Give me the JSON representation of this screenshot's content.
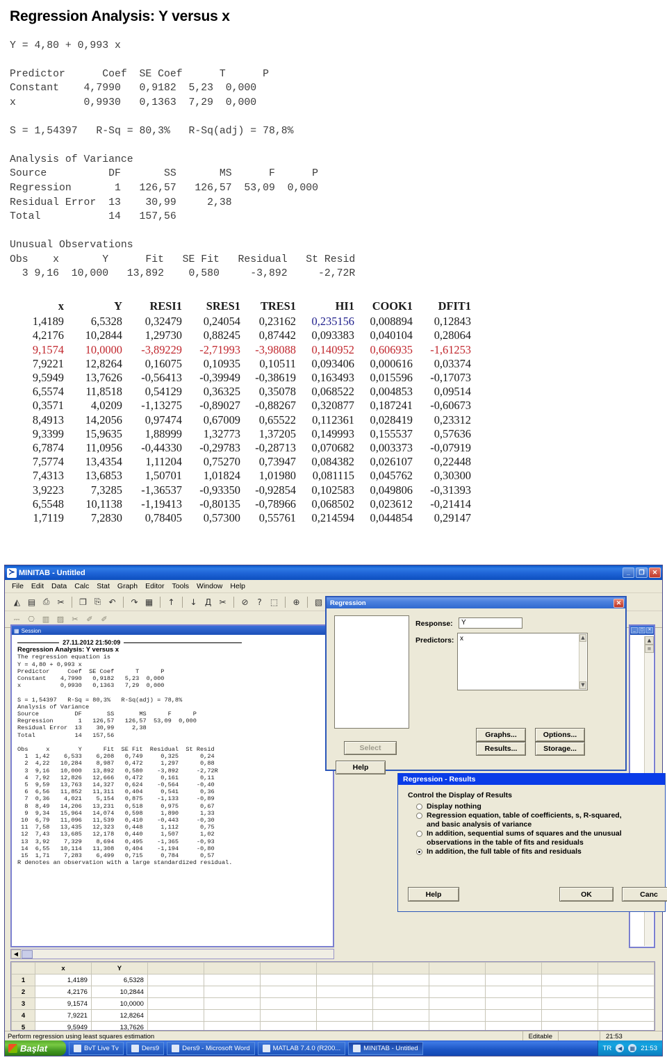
{
  "document": {
    "title": "Regression Analysis: Y versus x",
    "equation": "Y = 4,80 + 0,993 x",
    "coefficients_block": "Predictor      Coef  SE Coef      T      P\nConstant    4,7990   0,9182  5,23  0,000\nx           0,9930   0,1363  7,29  0,000",
    "summary_line": "S = 1,54397   R-Sq = 80,3%   R-Sq(adj) = 78,8%",
    "anova_block": "Analysis of Variance\nSource          DF       SS       MS      F      P\nRegression       1   126,57   126,57  53,09  0,000\nResidual Error  13    30,99     2,38\nTotal           14   157,56",
    "unusual_block": "Unusual Observations\nObs    x       Y      Fit   SE Fit   Residual   St Resid\n  3 9,16  10,000   13,892    0,580     -3,892     -2,72R"
  },
  "residual_table": {
    "headers": [
      "x",
      "Y",
      "RESI1",
      "SRES1",
      "TRES1",
      "HI1",
      "COOK1",
      "DFIT1"
    ],
    "highlight_red_row_index": 2,
    "highlight_blue_cell": {
      "row": 0,
      "col": 5
    },
    "colors": {
      "red": "#c1272d",
      "blue": "#20208c"
    },
    "rows": [
      [
        "1,4189",
        "6,5328",
        "0,32479",
        "0,24054",
        "0,23162",
        "0,235156",
        "0,008894",
        "0,12843"
      ],
      [
        "4,2176",
        "10,2844",
        "1,29730",
        "0,88245",
        "0,87442",
        "0,093383",
        "0,040104",
        "0,28064"
      ],
      [
        "9,1574",
        "10,0000",
        "-3,89229",
        "-2,71993",
        "-3,98088",
        "0,140952",
        "0,606935",
        "-1,61253"
      ],
      [
        "7,9221",
        "12,8264",
        "0,16075",
        "0,10935",
        "0,10511",
        "0,093406",
        "0,000616",
        "0,03374"
      ],
      [
        "9,5949",
        "13,7626",
        "-0,56413",
        "-0,39949",
        "-0,38619",
        "0,163493",
        "0,015596",
        "-0,17073"
      ],
      [
        "6,5574",
        "11,8518",
        "0,54129",
        "0,36325",
        "0,35078",
        "0,068522",
        "0,004853",
        "0,09514"
      ],
      [
        "0,3571",
        "4,0209",
        "-1,13275",
        "-0,89027",
        "-0,88267",
        "0,320877",
        "0,187241",
        "-0,60673"
      ],
      [
        "8,4913",
        "14,2056",
        "0,97474",
        "0,67009",
        "0,65522",
        "0,112361",
        "0,028419",
        "0,23312"
      ],
      [
        "9,3399",
        "15,9635",
        "1,88999",
        "1,32773",
        "1,37205",
        "0,149993",
        "0,155537",
        "0,57636"
      ],
      [
        "6,7874",
        "11,0956",
        "-0,44330",
        "-0,29783",
        "-0,28713",
        "0,070682",
        "0,003373",
        "-0,07919"
      ],
      [
        "7,5774",
        "13,4354",
        "1,11204",
        "0,75270",
        "0,73947",
        "0,084382",
        "0,026107",
        "0,22448"
      ],
      [
        "7,4313",
        "13,6853",
        "1,50701",
        "1,01824",
        "1,01980",
        "0,081115",
        "0,045762",
        "0,30300"
      ],
      [
        "3,9223",
        "7,3285",
        "-1,36537",
        "-0,93350",
        "-0,92854",
        "0,102583",
        "0,049806",
        "-0,31393"
      ],
      [
        "6,5548",
        "10,1138",
        "-1,19413",
        "-0,80135",
        "-0,78966",
        "0,068502",
        "0,023612",
        "-0,21414"
      ],
      [
        "1,7119",
        "7,2830",
        "0,78405",
        "0,57300",
        "0,55761",
        "0,214594",
        "0,044854",
        "0,29147"
      ]
    ]
  },
  "minitab": {
    "window_title": "MINITAB - Untitled",
    "logo_glyph": "≻",
    "window_buttons": {
      "minimize": "_",
      "restore": "❐",
      "close": "✕"
    },
    "menu": [
      "File",
      "Edit",
      "Data",
      "Calc",
      "Stat",
      "Graph",
      "Editor",
      "Tools",
      "Window",
      "Help"
    ],
    "toolbar_icons": [
      "open-folder-icon",
      "save-icon",
      "print-icon",
      "cut-icon",
      "copy-icon",
      "paste-icon",
      "undo-icon",
      "redo-icon",
      "session-icon",
      "up-arrow-icon",
      "down-arrow-icon",
      "find-icon",
      "find-next-icon",
      "cancel-icon",
      "help-icon",
      "3d-icon",
      "add-icon",
      "worksheet-icon",
      "project-icon",
      "info-icon",
      "history-icon",
      "report-icon"
    ],
    "toolbar_icons_glyphs": [
      "◭",
      "▤",
      "⎙",
      "✂",
      "❐",
      "⎘",
      "↶",
      "↷",
      "▦",
      "↑",
      "↓",
      "Д",
      "✂",
      "⊘",
      "?",
      "⬚",
      "⊕",
      "▧",
      "▤",
      "ⓘ",
      "≡",
      "▥"
    ],
    "toolbar2_icons": [
      "insert-cells-icon",
      "insert-column-icon",
      "insert-row-icon",
      "move-column-icon",
      "brush-icon",
      "brush-off-icon",
      "eraser-icon"
    ],
    "toolbar2_glyphs": [
      "⎓",
      "⎔",
      "▥",
      "▨",
      "✂",
      "✐",
      "✐"
    ],
    "session": {
      "window_title": "Session",
      "timestamp": "27.11.2012 21:50:09",
      "heading": "Regression Analysis: Y versus x",
      "body": "The regression equation is\nY = 4,80 + 0,993 x\nPredictor     Coef  SE Coef      T      P\nConstant    4,7990   0,9182   5,23  0,000\nx           0,9930   0,1363   7,29  0,000\n\nS = 1,54397   R-Sq = 80,3%   R-Sq(adj) = 78,8%\nAnalysis of Variance\nSource          DF       SS       MS      F      P\nRegression       1   126,57   126,57  53,09  0,000\nResidual Error  13    30,99     2,38\nTotal           14   157,56\n\nObs     x        Y      Fit  SE Fit  Residual  St Resid\n  1  1,42    6,533    6,208   0,749     0,325      0,24\n  2  4,22   10,284    8,987   0,472     1,297      0,88\n  3  9,16   10,000   13,892   0,580    -3,892     -2,72R\n  4  7,92   12,826   12,666   0,472     0,161      0,11\n  5  9,59   13,763   14,327   0,624    -0,564     -0,40\n  6  6,56   11,852   11,311   0,404     0,541      0,36\n  7  0,36    4,021    5,154   0,875    -1,133     -0,89\n  8  8,49   14,206   13,231   0,518     0,975      0,67\n  9  9,34   15,964   14,074   0,598     1,890      1,33\n 10  6,79   11,096   11,539   0,410    -0,443     -0,30\n 11  7,58   13,435   12,323   0,448     1,112      0,75\n 12  7,43   13,685   12,178   0,440     1,507      1,02\n 13  3,92    7,329    8,694   0,495    -1,365     -0,93\n 14  6,55   10,114   11,308   0,404    -1,194     -0,80\n 15  1,71    7,283    6,499   0,715     0,784      0,57\nR denotes an observation with a large standardized residual."
    },
    "worksheet": {
      "columns": [
        "x",
        "Y"
      ],
      "rows": [
        {
          "n": "1",
          "x": "1,4189",
          "y": "6,5328"
        },
        {
          "n": "2",
          "x": "4,2176",
          "y": "10,2844"
        },
        {
          "n": "3",
          "x": "9,1574",
          "y": "10,0000"
        },
        {
          "n": "4",
          "x": "7,9221",
          "y": "12,8264"
        },
        {
          "n": "5",
          "x": "9,5949",
          "y": "13,7626"
        }
      ]
    },
    "statusbar": {
      "message": "Perform regression using least squares estimation",
      "mode": "Editable",
      "time": "21:53"
    },
    "taskbar": {
      "start": "Başlat",
      "items": [
        {
          "label": "BvT Live Tv",
          "icon": "tv-icon",
          "active": false
        },
        {
          "label": "Ders9",
          "icon": "folder-icon",
          "active": false
        },
        {
          "label": "Ders9 - Microsoft Word",
          "icon": "word-icon",
          "active": false
        },
        {
          "label": "MATLAB 7.4.0 (R200...",
          "icon": "matlab-icon",
          "active": false
        },
        {
          "label": "MINITAB - Untitled",
          "icon": "minitab-icon",
          "active": true
        }
      ],
      "tray": {
        "language": "TR",
        "clock": "21:53"
      }
    }
  },
  "regression_dialog": {
    "title": "Regression",
    "close_glyph": "✕",
    "response_label": "Response:",
    "response_value": "Y",
    "predictors_label": "Predictors:",
    "predictors_value": "x",
    "buttons": {
      "graphs": "Graphs...",
      "options": "Options...",
      "results": "Results...",
      "storage": "Storage...",
      "select": "Select",
      "help": "Help"
    }
  },
  "results_dialog": {
    "title": "Regression - Results",
    "group_label": "Control the Display of Results",
    "options": [
      {
        "label": "Display nothing",
        "selected": false,
        "cont": ""
      },
      {
        "label": "Regression equation, table of coefficients, s, R-squared,",
        "selected": false,
        "cont": "and basic analysis of variance"
      },
      {
        "label": "In addition, sequential sums of squares and the unusual",
        "selected": false,
        "cont": "observations in the table of fits and residuals"
      },
      {
        "label": "In addition, the full table of fits and residuals",
        "selected": true,
        "cont": ""
      }
    ],
    "buttons": {
      "help": "Help",
      "ok": "OK",
      "cancel": "Canc"
    }
  }
}
